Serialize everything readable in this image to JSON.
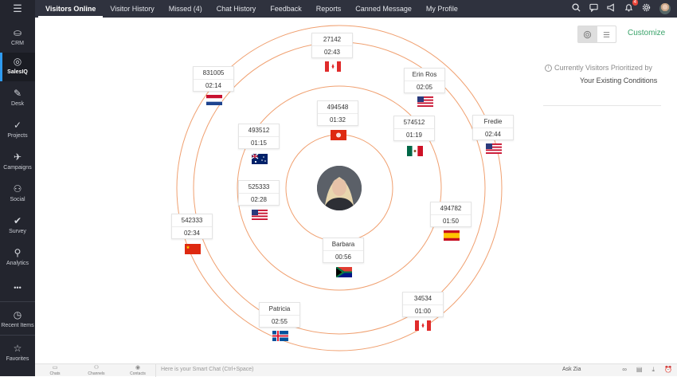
{
  "sidebar": {
    "menu_icon": "hamburger-icon",
    "items": [
      {
        "label": "CRM",
        "icon": "crm-icon",
        "glyph": "⛀"
      },
      {
        "label": "SalesIQ",
        "icon": "salesiq-icon",
        "glyph": "◎"
      },
      {
        "label": "Desk",
        "icon": "desk-icon",
        "glyph": "✎"
      },
      {
        "label": "Projects",
        "icon": "projects-icon",
        "glyph": "✓"
      },
      {
        "label": "Campaigns",
        "icon": "campaigns-icon",
        "glyph": "✈"
      },
      {
        "label": "Social",
        "icon": "social-icon",
        "glyph": "⚇"
      },
      {
        "label": "Survey",
        "icon": "survey-icon",
        "glyph": "✔"
      },
      {
        "label": "Analytics",
        "icon": "analytics-icon",
        "glyph": "⚲"
      },
      {
        "label": "",
        "icon": "more-icon",
        "glyph": "•••"
      },
      {
        "label": "Recent Items",
        "icon": "recent-items-icon",
        "glyph": "◷"
      },
      {
        "label": "Favorites",
        "icon": "favorites-icon",
        "glyph": "☆"
      }
    ]
  },
  "tabs": [
    {
      "label": "Visitors Online",
      "active": true
    },
    {
      "label": "Visitor History"
    },
    {
      "label": "Missed (4)"
    },
    {
      "label": "Chat History"
    },
    {
      "label": "Feedback"
    },
    {
      "label": "Reports"
    },
    {
      "label": "Canned Message"
    },
    {
      "label": "My Profile"
    }
  ],
  "header_icons": {
    "search": "search-icon",
    "chat": "chat-bubble-icon",
    "megaphone": "megaphone-icon",
    "notification_count": "4",
    "settings": "gear-icon"
  },
  "visitors": [
    {
      "id": "27142",
      "time": "02:43",
      "flag": "CA"
    },
    {
      "id": "831005",
      "time": "02:14",
      "flag": "NL"
    },
    {
      "id": "Erin Ros",
      "time": "02:05",
      "flag": "US"
    },
    {
      "id": "494548",
      "time": "01:32",
      "flag": "HK"
    },
    {
      "id": "574512",
      "time": "01:19",
      "flag": "MX"
    },
    {
      "id": "Fredie",
      "time": "02:44",
      "flag": "US"
    },
    {
      "id": "493512",
      "time": "01:15",
      "flag": "AU"
    },
    {
      "id": "525333",
      "time": "02:28",
      "flag": "US"
    },
    {
      "id": "494782",
      "time": "01:50",
      "flag": "ES"
    },
    {
      "id": "542333",
      "time": "02:34",
      "flag": "CN"
    },
    {
      "id": "Barbara",
      "time": "00:56",
      "flag": "ZA"
    },
    {
      "id": "Patricia",
      "time": "02:55",
      "flag": "IS"
    },
    {
      "id": "34534",
      "time": "01:00",
      "flag": "CA"
    }
  ],
  "right_panel": {
    "customize_label": "Customize",
    "info_line1": "Currently Visitors Prioritized by",
    "info_line2": "Your Existing Conditions",
    "radar_view_icon": "radar-view-icon",
    "list_view_icon": "list-view-icon"
  },
  "bottombar": {
    "chats_label": "Chats",
    "channels_label": "Channels",
    "contacts_label": "Contacts",
    "smart_chat_placeholder": "Here is your Smart Chat (Ctrl+Space)",
    "ask_zia_label": "Ask Zia"
  },
  "colors": {
    "orbit": "#f0a070",
    "sidebar_bg": "#23252e",
    "topnav_bg": "#2f323e",
    "accent_green": "#3aa36a"
  }
}
